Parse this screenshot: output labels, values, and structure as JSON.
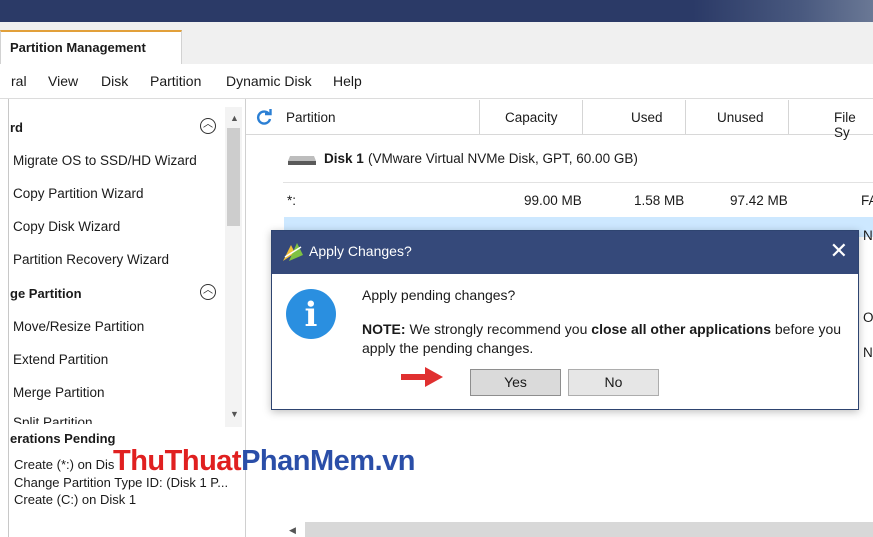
{
  "tab": {
    "label": "Partition Management"
  },
  "menu": [
    "ral",
    "View",
    "Disk",
    "Partition",
    "Dynamic Disk",
    "Help"
  ],
  "left_panel": {
    "wizard_header": "rd",
    "wizard_items": [
      "Migrate OS to SSD/HD Wizard",
      "Copy Partition Wizard",
      "Copy Disk Wizard",
      "Partition Recovery Wizard"
    ],
    "change_header": "ge Partition",
    "change_items": [
      "Move/Resize Partition",
      "Extend Partition",
      "Merge Partition",
      "Split Partition"
    ],
    "pending_header": "erations Pending",
    "pending_items": [
      "Create (*:) on Dis",
      "Change Partition Type ID: (Disk 1 P...",
      "Create (C:) on Disk 1"
    ]
  },
  "grid": {
    "columns": [
      "Partition",
      "Capacity",
      "Used",
      "Unused",
      "File Sy"
    ],
    "disk_label": "Disk 1",
    "disk_desc": "(VMware Virtual NVMe Disk, GPT, 60.00 GB)",
    "rows": [
      {
        "partition": "*:",
        "capacity": "99.00 MB",
        "used": "1.58 MB",
        "unused": "97.42 MB",
        "fs": "FA"
      }
    ],
    "fs_partial": [
      "N",
      "O",
      "N"
    ]
  },
  "dialog": {
    "title": "Apply Changes?",
    "question": "Apply pending changes?",
    "note_label": "NOTE:",
    "note_pre": "We strongly recommend you",
    "note_bold": "close all other applications",
    "note_post": "before you",
    "note_line2": "apply the pending changes.",
    "yes": "Yes",
    "no": "No"
  },
  "watermark": {
    "part1": "ThuThuat",
    "part2": "PhanMem",
    "part3": ".vn"
  },
  "colors": {
    "title_bar": "#35497a",
    "info_icon": "#2a8fe0",
    "selection": "#cde8ff",
    "tab_accent": "#e2a03a"
  }
}
